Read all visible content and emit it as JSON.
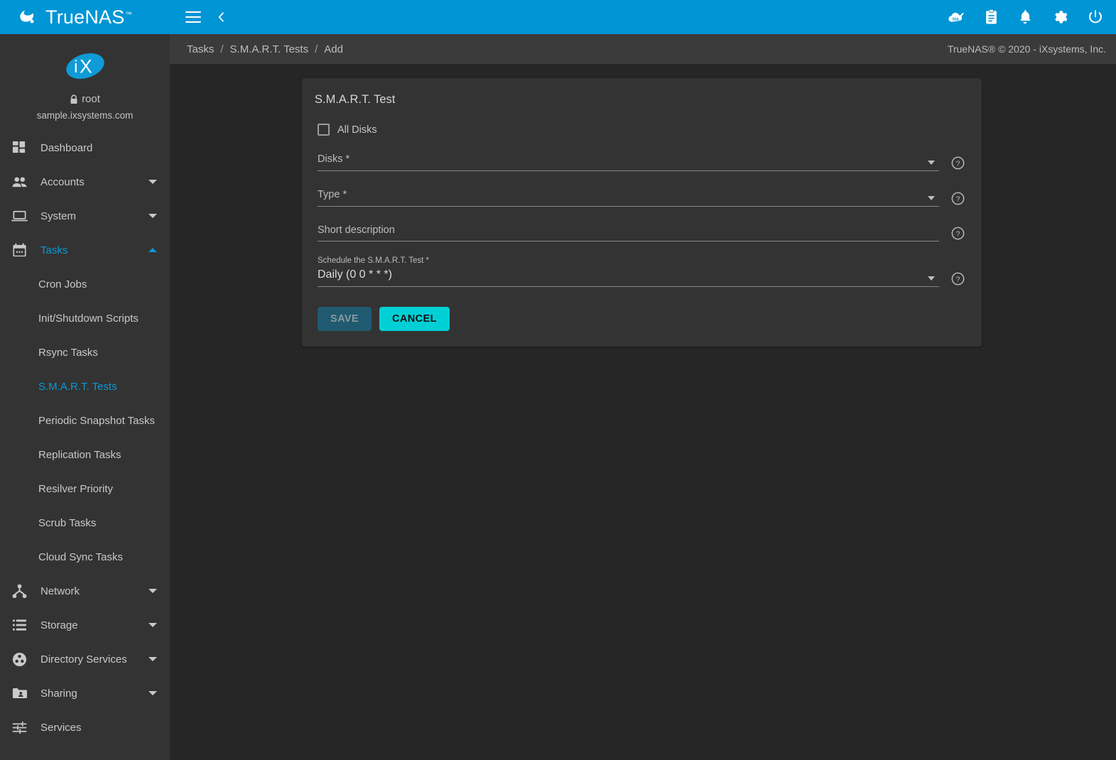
{
  "brand": {
    "name": "TrueNAS",
    "trademark": "™",
    "logo_icon": "truenas-wave-logo",
    "accent_color": "#0095d5"
  },
  "profile": {
    "avatar_icon": "ix-systems-logo",
    "lock_icon": "lock-icon",
    "username": "root",
    "hostname": "sample.ixsystems.com"
  },
  "sidebar": {
    "items": [
      {
        "label": "Dashboard",
        "icon": "dashboard-grid-icon",
        "expandable": false,
        "active": false
      },
      {
        "label": "Accounts",
        "icon": "accounts-people-icon",
        "expandable": true,
        "expanded": false,
        "active": false
      },
      {
        "label": "System",
        "icon": "system-laptop-icon",
        "expandable": true,
        "expanded": false,
        "active": false
      },
      {
        "label": "Tasks",
        "icon": "tasks-calendar-icon",
        "expandable": true,
        "expanded": true,
        "active": true
      }
    ],
    "task_subitems": [
      {
        "label": "Cron Jobs",
        "active": false
      },
      {
        "label": "Init/Shutdown Scripts",
        "active": false
      },
      {
        "label": "Rsync Tasks",
        "active": false
      },
      {
        "label": "S.M.A.R.T. Tests",
        "active": true
      },
      {
        "label": "Periodic Snapshot Tasks",
        "active": false
      },
      {
        "label": "Replication Tasks",
        "active": false
      },
      {
        "label": "Resilver Priority",
        "active": false
      },
      {
        "label": "Scrub Tasks",
        "active": false
      },
      {
        "label": "Cloud Sync Tasks",
        "active": false
      }
    ],
    "items_after": [
      {
        "label": "Network",
        "icon": "network-nodes-icon",
        "expandable": true,
        "expanded": false,
        "active": false
      },
      {
        "label": "Storage",
        "icon": "storage-server-icon",
        "expandable": true,
        "expanded": false,
        "active": false
      },
      {
        "label": "Directory Services",
        "icon": "directory-services-icon",
        "expandable": true,
        "expanded": false,
        "active": false
      },
      {
        "label": "Sharing",
        "icon": "sharing-folder-user-icon",
        "expandable": true,
        "expanded": false,
        "active": false
      },
      {
        "label": "Services",
        "icon": "services-sliders-icon",
        "expandable": false,
        "active": false
      }
    ],
    "active_color": "#0b99d6"
  },
  "topbar": {
    "menu_icon": "hamburger-menu-icon",
    "back_icon": "chevron-left-icon",
    "icons": [
      {
        "name": "ha-status-icon",
        "label": "HA"
      },
      {
        "name": "jobs-clipboard-icon",
        "label": "Jobs"
      },
      {
        "name": "alerts-bell-icon",
        "label": "Alerts"
      },
      {
        "name": "settings-gear-icon",
        "label": "Settings"
      },
      {
        "name": "power-icon",
        "label": "Power"
      }
    ]
  },
  "breadcrumb": {
    "items": [
      "Tasks",
      "S.M.A.R.T. Tests",
      "Add"
    ],
    "separator": "/",
    "copyright": "TrueNAS® © 2020 - iXsystems, Inc."
  },
  "form": {
    "title": "S.M.A.R.T. Test",
    "all_disks": {
      "label": "All Disks",
      "checked": false
    },
    "fields": [
      {
        "name": "disks",
        "label": "Disks *",
        "value": "",
        "type": "select",
        "has_caret": true,
        "help_icon": "help-circle-icon"
      },
      {
        "name": "type",
        "label": "Type *",
        "value": "",
        "type": "select",
        "has_caret": true,
        "help_icon": "help-circle-icon"
      },
      {
        "name": "short-description",
        "label": "Short description",
        "value": "",
        "type": "text",
        "has_caret": false,
        "help_icon": "help-circle-icon"
      },
      {
        "name": "schedule",
        "label": "Schedule the S.M.A.R.T. Test *",
        "value": "Daily (0 0 * * *)",
        "type": "select",
        "has_caret": true,
        "help_icon": "help-circle-icon"
      }
    ],
    "buttons": {
      "save": {
        "label": "SAVE",
        "disabled": true,
        "color": "#1f5a70"
      },
      "cancel": {
        "label": "CANCEL",
        "disabled": false,
        "color": "#00d0d6"
      }
    }
  }
}
